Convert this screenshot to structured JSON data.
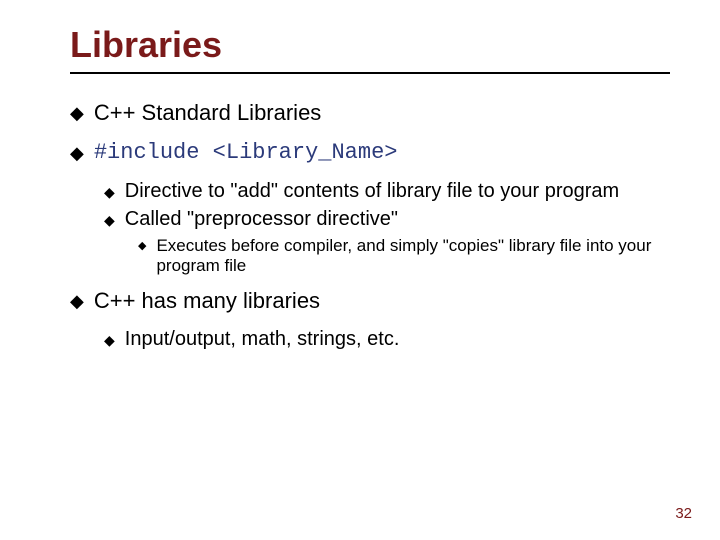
{
  "title": "Libraries",
  "items": {
    "p1": "C++ Standard Libraries",
    "p2_code": "#include <Library_Name>",
    "p2_s1": "Directive to \"add\" contents of library file to your program",
    "p2_s2": "Called \"preprocessor directive\"",
    "p2_s2_a": "Executes before compiler, and simply \"copies\" library file into your program file",
    "p3": "C++ has many libraries",
    "p3_s1": "Input/output, math, strings, etc."
  },
  "page_number": "32"
}
